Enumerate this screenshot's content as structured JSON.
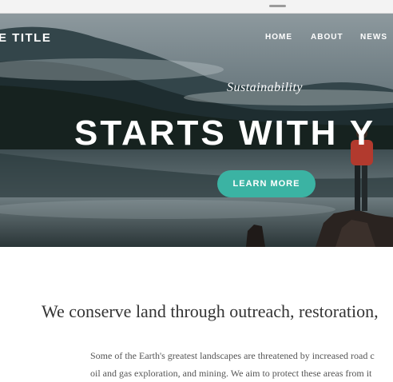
{
  "site": {
    "title": "E TITLE"
  },
  "nav": {
    "items": [
      "HOME",
      "ABOUT",
      "NEWS"
    ]
  },
  "hero": {
    "eyebrow": "Sustainability",
    "headline": "STARTS WITH Y",
    "cta_label": "LEARN MORE"
  },
  "content": {
    "tagline": "We conserve land through outreach, restoration,",
    "body_lines": [
      "Some of the Earth's greatest landscapes are threatened by increased road c",
      "oil and gas exploration, and mining. We aim to protect these areas from it"
    ]
  },
  "colors": {
    "accent": "#3bb3a3",
    "hero_text": "#ffffff",
    "body_text": "#555555"
  }
}
